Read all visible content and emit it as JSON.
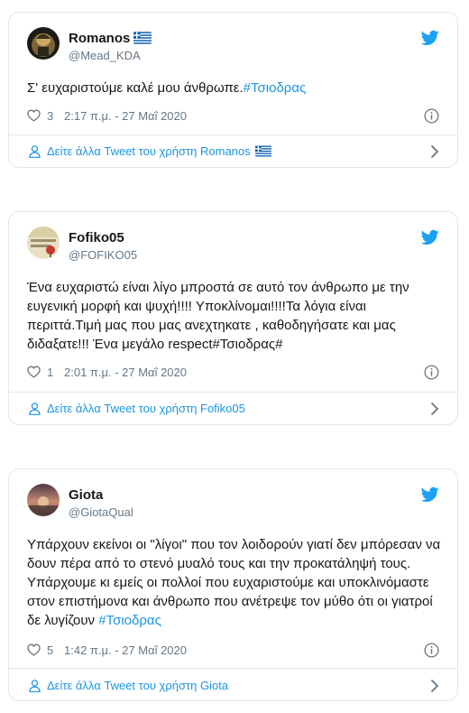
{
  "colors": {
    "link": "#1b95e0",
    "text": "#14171a",
    "muted": "#657786",
    "border": "#e1e8ed",
    "twitter_blue": "#1da1f2"
  },
  "tweets": [
    {
      "name": "Romanos",
      "handle": "@Mead_KDA",
      "has_flag": true,
      "text": "Σ' ευχαριστούμε καλέ μου άνθρωπε.",
      "hashtag": "#Τσιοδρας",
      "likes": "3",
      "time": "2:17 π.μ. - 27 Μαΐ 2020",
      "more": "Δείτε άλλα Tweet του χρήστη Romanos",
      "icons": [
        "avatar",
        "greek-flag-icon",
        "twitter-bird-icon",
        "heart-icon",
        "info-icon",
        "person-icon",
        "chevron-right-icon"
      ]
    },
    {
      "name": "Fofiko05",
      "handle": "@FOFIKO05",
      "has_flag": false,
      "text_lines": [
        "Ένα ευχαριστώ είναι λίγο μπροστά σε αυτό τον άνθρωπο με την",
        "ευγενική μορφή και ψυχή!!!! Υποκλίνομαι!!!!Τα λόγια είναι",
        "περιττά.Τιμή μας που μας ανεχτηκατε , καθοδηγήσατε και μας",
        "διδαξατε!!! Ένα μεγάλο  respect#Τσιοδρας#"
      ],
      "likes": "1",
      "time": "2:01 π.μ. - 27 Μαΐ 2020",
      "more": "Δείτε άλλα Tweet του χρήστη Fofiko05"
    },
    {
      "name": "Giota",
      "handle": "@GiotaQual",
      "has_flag": false,
      "text_lines": [
        "Υπάρχουν εκείνοι οι \"λίγοι\" που τον λοιδορούν γιατί δεν μπόρεσαν να",
        "δουν πέρα από το στενό μυαλό τους και την προκατάληψή τους.",
        "Υπάρχουμε κι εμείς οι πολλοί που  ευχαριστούμε και υποκλινόμαστε",
        "στον επιστήμονα και άνθρωπο που ανέτρεψε τον μύθο ότι οι γιατροί",
        "δε λυγίζουν "
      ],
      "hashtag": "#Τσιοδρας",
      "likes": "5",
      "time": "1:42 π.μ. - 27 Μαΐ 2020",
      "more": "Δείτε άλλα Tweet του χρήστη Giota"
    }
  ]
}
